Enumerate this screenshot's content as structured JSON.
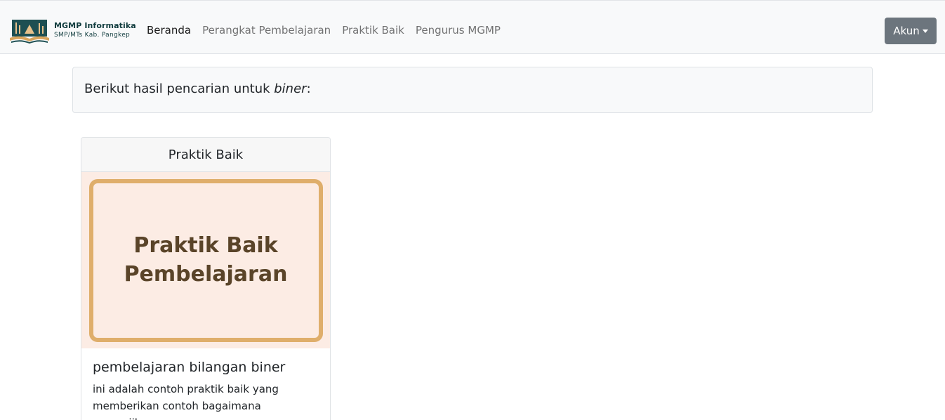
{
  "brand": {
    "title": "MGMP Informatika",
    "subtitle": "SMP/MTs Kab. Pangkep"
  },
  "nav": {
    "items": [
      {
        "label": "Beranda",
        "active": true
      },
      {
        "label": "Perangkat Pembelajaran",
        "active": false
      },
      {
        "label": "Praktik Baik",
        "active": false
      },
      {
        "label": "Pengurus MGMP",
        "active": false
      }
    ],
    "account_label": "Akun"
  },
  "search": {
    "prefix": "Berikut hasil pencarian untuk ",
    "term": "biner",
    "suffix": ":"
  },
  "results": [
    {
      "category": "Praktik Baik",
      "image_text_line1": "Praktik Baik",
      "image_text_line2": "Pembelajaran",
      "title": "pembelajaran bilangan biner",
      "description": "ini adalah contoh praktik baik yang memberikan contoh bagaimana menyajikan"
    }
  ],
  "colors": {
    "navbar_bg": "#f8f9fa",
    "account_button": "#6c757d",
    "image_bg": "#fcece4",
    "image_frame": "#dfae6b",
    "image_text": "#5a4429"
  }
}
